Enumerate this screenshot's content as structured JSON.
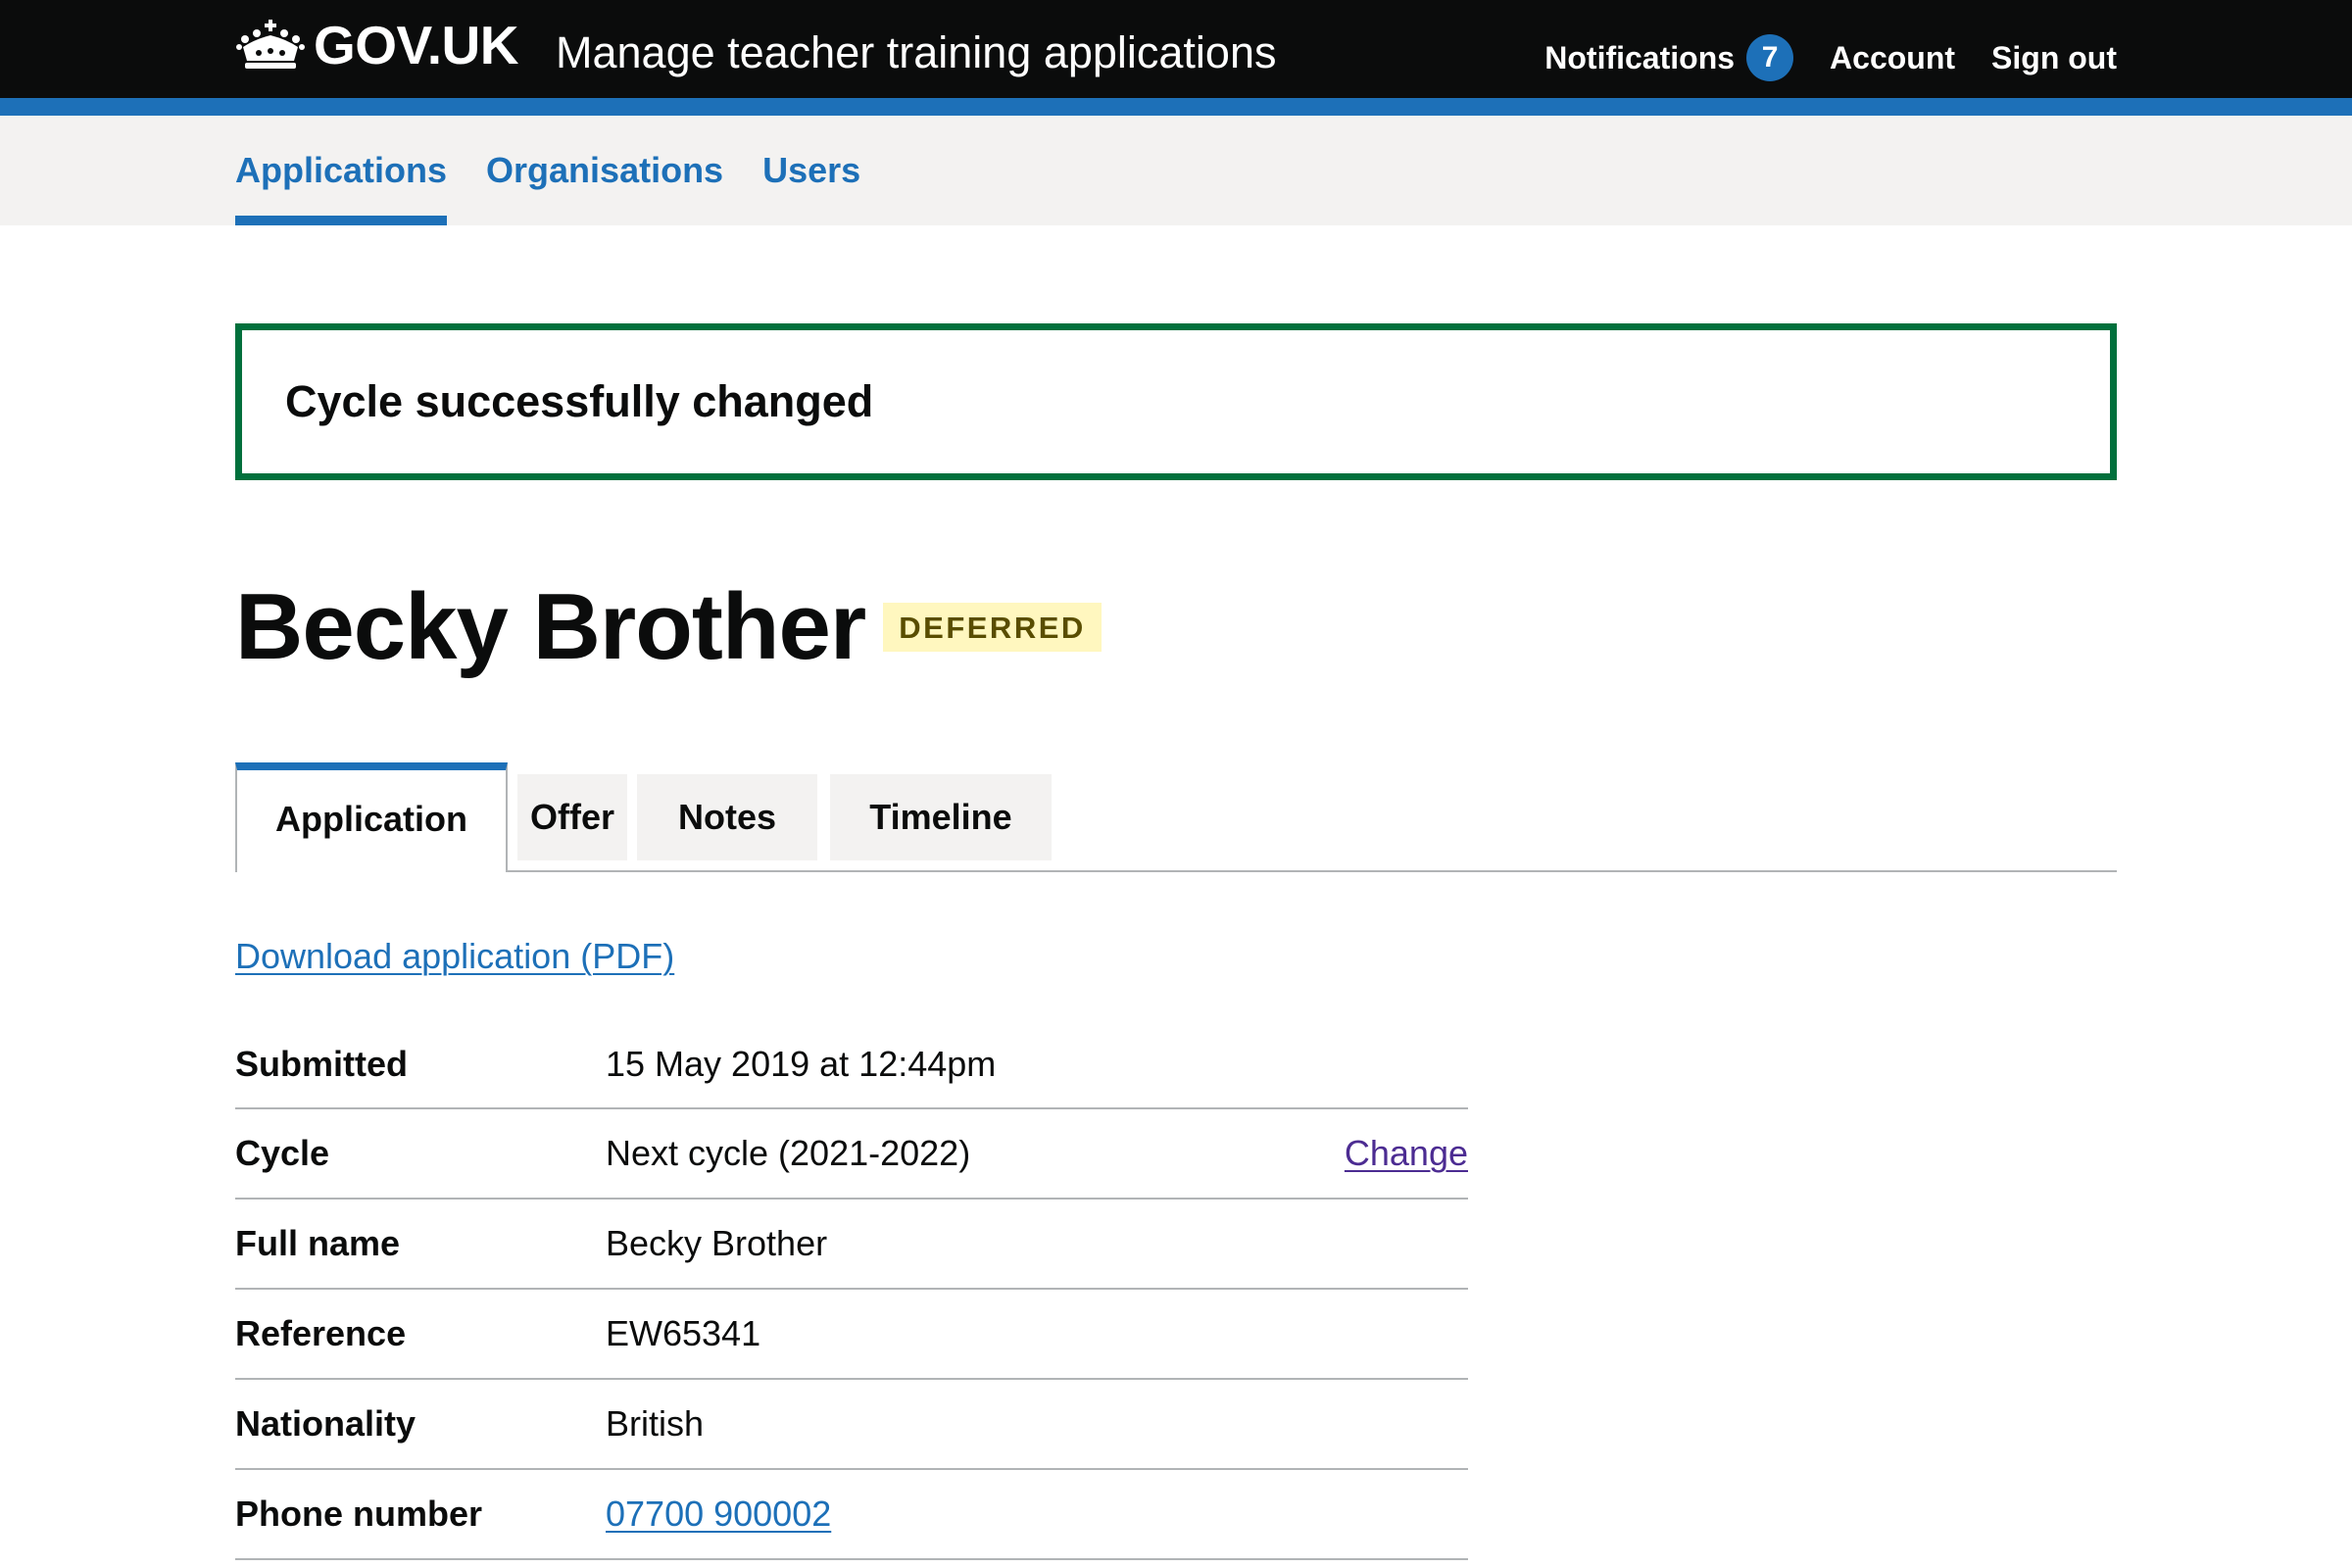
{
  "header": {
    "logo_text": "GOV.UK",
    "service_name": "Manage teacher training applications",
    "nav": {
      "notifications_label": "Notifications",
      "notifications_count": "7",
      "account_label": "Account",
      "sign_out_label": "Sign out"
    }
  },
  "primary_nav": {
    "items": [
      {
        "label": "Applications",
        "active": true
      },
      {
        "label": "Organisations",
        "active": false
      },
      {
        "label": "Users",
        "active": false
      }
    ]
  },
  "banner": {
    "message": "Cycle successfully changed"
  },
  "page": {
    "title": "Becky Brother",
    "status_tag": "DEFERRED"
  },
  "tabs": [
    {
      "label": "Application",
      "active": true
    },
    {
      "label": "Offer",
      "active": false
    },
    {
      "label": "Notes",
      "active": false
    },
    {
      "label": "Timeline",
      "active": false
    }
  ],
  "download_link": "Download application (PDF)",
  "summary": {
    "rows": [
      {
        "key": "Submitted",
        "value": "15 May 2019 at 12:44pm"
      },
      {
        "key": "Cycle",
        "value": "Next cycle (2021-2022)",
        "action": "Change"
      },
      {
        "key": "Full name",
        "value": "Becky Brother"
      },
      {
        "key": "Reference",
        "value": "EW65341"
      },
      {
        "key": "Nationality",
        "value": "British"
      },
      {
        "key": "Phone number",
        "value": "07700 900002"
      }
    ]
  },
  "colors": {
    "header_bg": "#0b0c0c",
    "brand_blue": "#1d70b8",
    "success_green": "#00703c",
    "tag_bg": "#fff7bf",
    "tag_text": "#594d00",
    "visited_link": "#4c2c92"
  }
}
